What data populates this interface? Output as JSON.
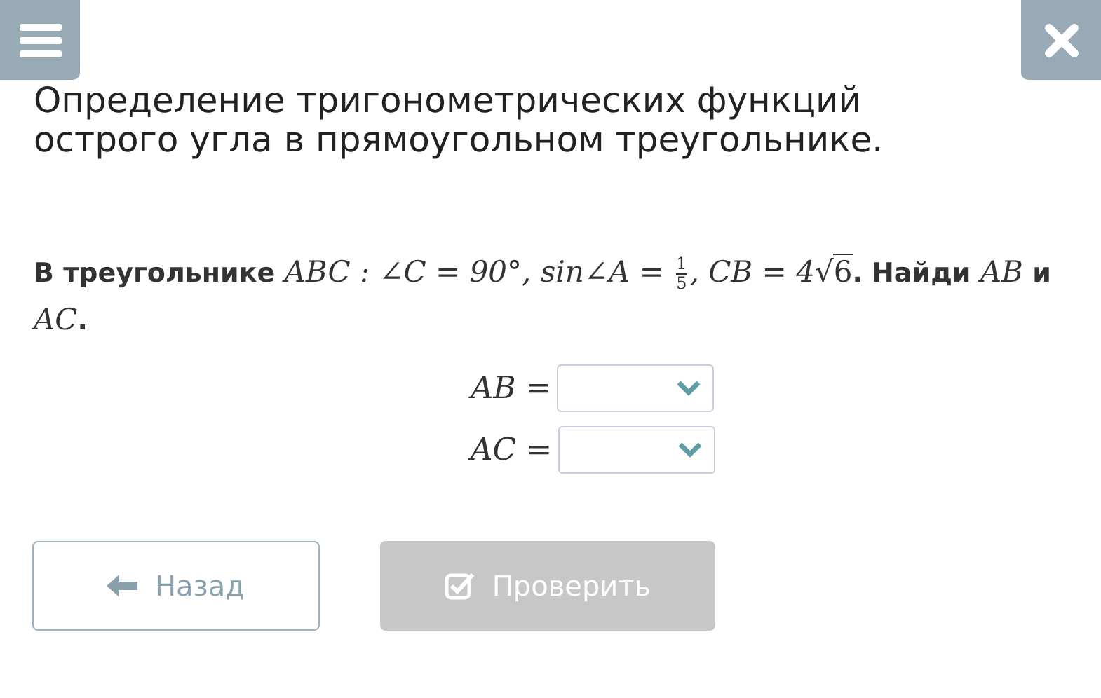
{
  "title": "Определение тригонометрических функций острого угла в прямоугольном треугольнике.",
  "question": [
    {
      "kind": "text",
      "text": "В треугольнике "
    },
    {
      "kind": "math",
      "text": "ABC : ∠C = 90°, sin∠A = "
    },
    {
      "kind": "fraction",
      "numerator": "1",
      "denominator": "5"
    },
    {
      "kind": "math",
      "text": ", CB = 4"
    },
    {
      "kind": "sqrt",
      "sign": "√",
      "text": "6"
    },
    {
      "kind": "text",
      "text": ". Найди "
    },
    {
      "kind": "math",
      "text": "AB"
    },
    {
      "kind": "text",
      "text": " и "
    },
    {
      "kind": "math",
      "text": "AC"
    },
    {
      "kind": "text",
      "text": "."
    }
  ],
  "answers": [
    {
      "label": "AB ="
    },
    {
      "label": "AC ="
    }
  ],
  "buttons": [
    {
      "kind": "back",
      "label": "Назад",
      "disabled": false
    },
    {
      "kind": "check",
      "label": "Проверить",
      "disabled": true
    }
  ]
}
